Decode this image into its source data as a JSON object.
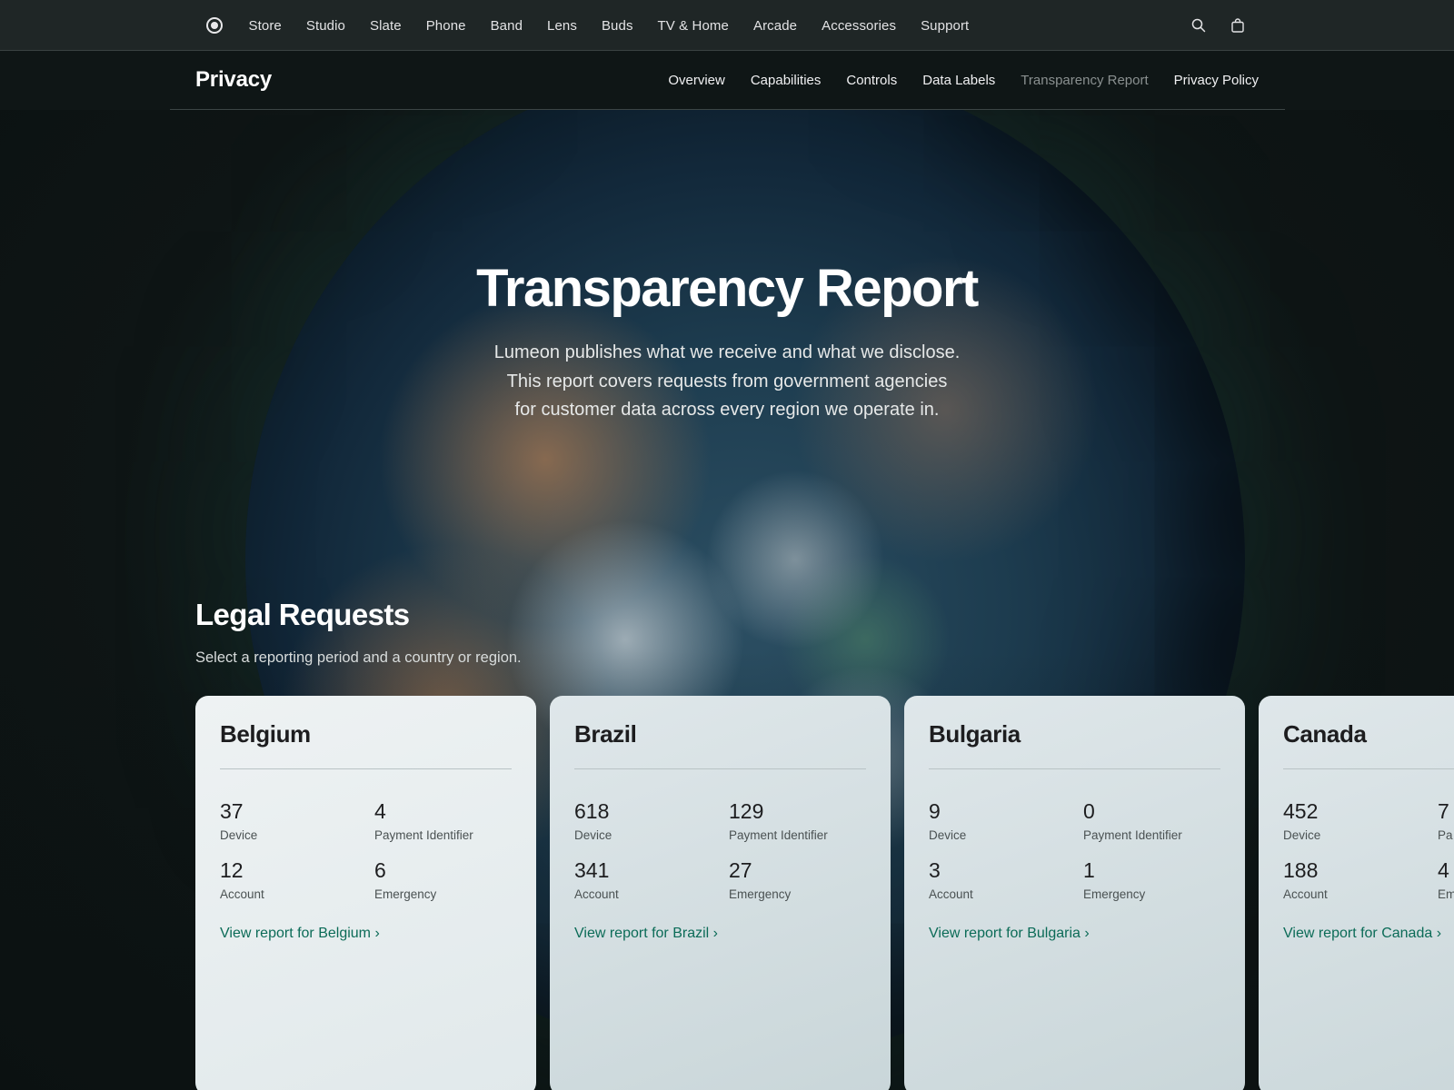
{
  "globalnav": {
    "logo": "brand-logo-icon",
    "links": [
      "Store",
      "Studio",
      "Slate",
      "Phone",
      "Band",
      "Lens",
      "Buds",
      "TV & Home",
      "Arcade",
      "Accessories",
      "Support"
    ],
    "search_icon": "search-icon",
    "bag_icon": "bag-icon"
  },
  "localnav": {
    "title": "Privacy",
    "items": [
      {
        "label": "Overview",
        "current": false
      },
      {
        "label": "Capabilities",
        "current": false
      },
      {
        "label": "Controls",
        "current": false
      },
      {
        "label": "Data Labels",
        "current": false
      },
      {
        "label": "Transparency Report",
        "current": true
      },
      {
        "label": "Privacy Policy",
        "current": false
      }
    ]
  },
  "hero": {
    "title": "Transparency Report",
    "subtitle_lines": [
      "Lumeon publishes what we receive and what we disclose.",
      "This report covers requests from government agencies",
      "for customer data across every region we operate in."
    ]
  },
  "legal": {
    "title": "Legal Requests",
    "subtitle": "Select a reporting period and a country or region."
  },
  "cards": [
    {
      "country": "Belgium",
      "stats": [
        {
          "value": "37",
          "label": "Device"
        },
        {
          "value": "4",
          "label": "Payment Identifier"
        },
        {
          "value": "12",
          "label": "Account"
        },
        {
          "value": "6",
          "label": "Emergency"
        }
      ],
      "link": "View report for Belgium ›"
    },
    {
      "country": "Brazil",
      "stats": [
        {
          "value": "618",
          "label": "Device"
        },
        {
          "value": "129",
          "label": "Payment Identifier"
        },
        {
          "value": "341",
          "label": "Account"
        },
        {
          "value": "27",
          "label": "Emergency"
        }
      ],
      "link": "View report for Brazil ›"
    },
    {
      "country": "Bulgaria",
      "stats": [
        {
          "value": "9",
          "label": "Device"
        },
        {
          "value": "0",
          "label": "Payment Identifier"
        },
        {
          "value": "3",
          "label": "Account"
        },
        {
          "value": "1",
          "label": "Emergency"
        }
      ],
      "link": "View report for Bulgaria ›"
    },
    {
      "country": "Canada",
      "stats": [
        {
          "value": "452",
          "label": "Device"
        },
        {
          "value": "7",
          "label": "Pa"
        },
        {
          "value": "188",
          "label": "Account"
        },
        {
          "value": "4",
          "label": "Em"
        }
      ],
      "link": "View report for Canada ›"
    }
  ],
  "colors": {
    "accent_link": "#0b6b57",
    "nav_bg": "#1f2626",
    "page_bg": "#0f1616"
  }
}
